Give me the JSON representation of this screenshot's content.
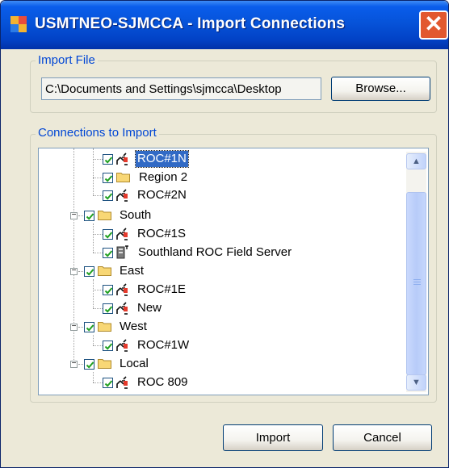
{
  "window": {
    "title": "USMTNEO-SJMCCA - Import Connections",
    "close_glyph": "✕"
  },
  "import_file": {
    "group_label": "Import File",
    "path_value": "C:\\Documents and Settings\\sjmcca\\Desktop",
    "browse_label": "Browse..."
  },
  "connections": {
    "group_label": "Connections to Import",
    "tree": [
      {
        "label": "ROC#1N",
        "icon": "connection-icon",
        "checked": true,
        "selected": true
      },
      {
        "label": "Region 2",
        "icon": "folder-icon",
        "checked": true
      },
      {
        "label": "ROC#2N",
        "icon": "connection-icon",
        "checked": true
      },
      {
        "label": "South",
        "icon": "folder-icon",
        "checked": true,
        "expander": "minus"
      },
      {
        "label": "ROC#1S",
        "icon": "connection-icon",
        "checked": true
      },
      {
        "label": "Southland ROC Field Server",
        "icon": "server-icon",
        "checked": true
      },
      {
        "label": "East",
        "icon": "folder-icon",
        "checked": true,
        "expander": "minus"
      },
      {
        "label": "ROC#1E",
        "icon": "connection-icon",
        "checked": true
      },
      {
        "label": "New",
        "icon": "connection-icon",
        "checked": true
      },
      {
        "label": "West",
        "icon": "folder-icon",
        "checked": true,
        "expander": "minus"
      },
      {
        "label": "ROC#1W",
        "icon": "connection-icon",
        "checked": true
      },
      {
        "label": "Local",
        "icon": "folder-icon",
        "checked": true,
        "expander": "minus"
      },
      {
        "label": "ROC 809",
        "icon": "connection-icon",
        "checked": true
      }
    ],
    "scroll_up_glyph": "▲",
    "scroll_down_glyph": "▼"
  },
  "buttons": {
    "import_label": "Import",
    "cancel_label": "Cancel"
  },
  "colors": {
    "titlebar": "#0653D9",
    "group_label": "#0046D5",
    "selection": "#316AC5",
    "close": "#E2582F"
  }
}
